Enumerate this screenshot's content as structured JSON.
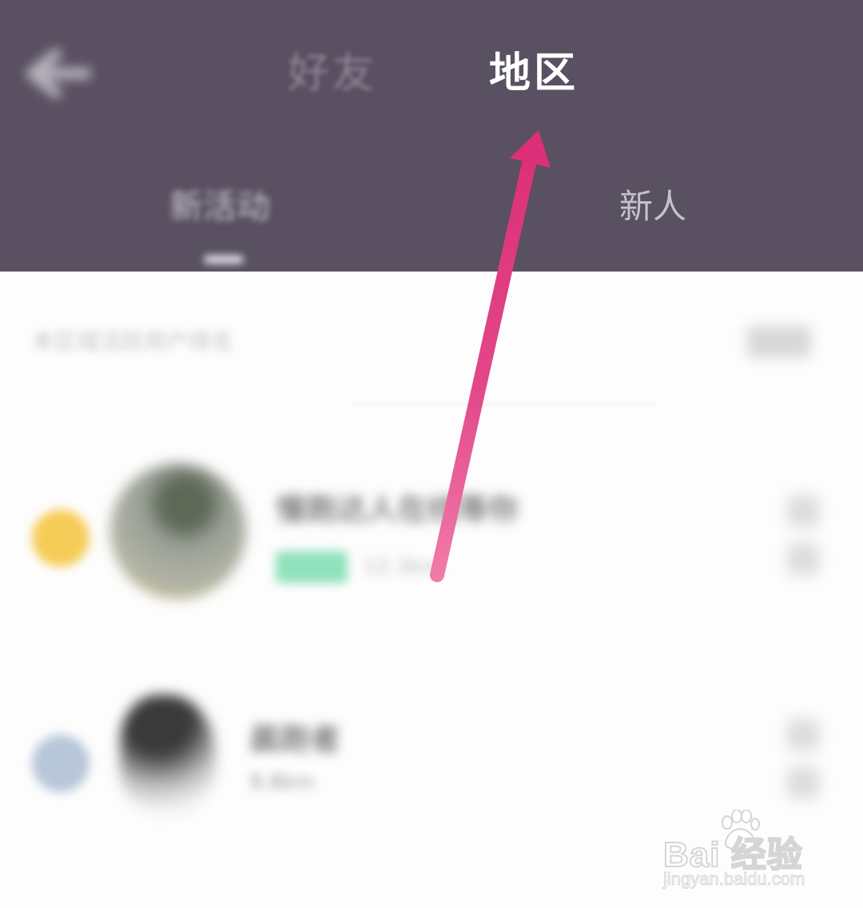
{
  "header": {
    "tabs": [
      {
        "label": "好友",
        "active": false
      },
      {
        "label": "地区",
        "active": true
      }
    ],
    "subtabs": [
      {
        "label": "新活动",
        "active": true
      },
      {
        "label": "新人",
        "active": false
      }
    ]
  },
  "notice": {
    "text": "本区域活跃用户排名",
    "more_label": "规则"
  },
  "list": {
    "items": [
      {
        "rank_color": "#f6cc58",
        "nickname": "慢跑达人在线等你",
        "tag": "运动",
        "meta": "12.3km"
      },
      {
        "rank_color": "#b7c6d8",
        "nickname": "晨跑者",
        "tag": "",
        "meta": "9.8km"
      }
    ]
  },
  "annotation": {
    "arrow_color": "#dd2f77",
    "target": "地区"
  },
  "watermark": {
    "logo": "Bai  经验",
    "logo_paw_text": "du",
    "url": "jingyan.baidu.com"
  },
  "colors": {
    "header_bg": "#595062",
    "page_bg": "#fdfdfd"
  }
}
